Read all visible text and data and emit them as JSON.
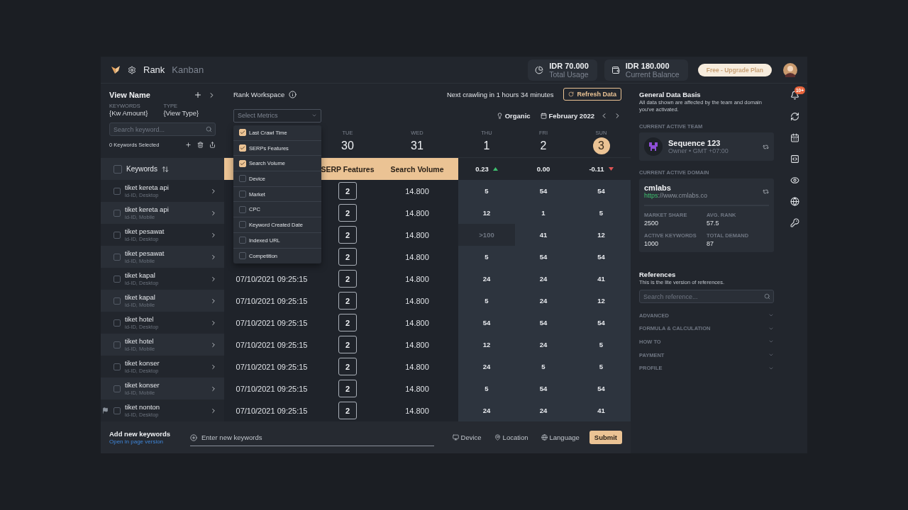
{
  "topbar": {
    "section": "Rank",
    "view": "Kanban",
    "usage": {
      "amount": "IDR 70.000",
      "label": "Total Usage"
    },
    "balance": {
      "amount": "IDR 180.000",
      "label": "Current Balance"
    },
    "plan_button": "Free - Upgrade Plan"
  },
  "view_panel": {
    "title": "View Name",
    "fields": [
      {
        "label": "KEYWORDS",
        "value": "{Kw Amount}"
      },
      {
        "label": "TYPE",
        "value": "{View Type}"
      }
    ],
    "search": {
      "placeholder": "Search keyword..."
    },
    "selected_count": "0 Keywords Selected",
    "column_header": "Keywords",
    "select_all_checked": false,
    "keywords": [
      {
        "name": "tiket kereta api",
        "meta": "id-ID, Desktop",
        "flagged": false,
        "checked": false
      },
      {
        "name": "tiket kereta api",
        "meta": "id-ID, Mobile",
        "flagged": false,
        "checked": false
      },
      {
        "name": "tiket pesawat",
        "meta": "id-ID, Desktop",
        "flagged": false,
        "checked": false
      },
      {
        "name": "tiket pesawat",
        "meta": "id-ID, Mobile",
        "flagged": false,
        "checked": false
      },
      {
        "name": "tiket kapal",
        "meta": "id-ID, Desktop",
        "flagged": false,
        "checked": false
      },
      {
        "name": "tiket kapal",
        "meta": "id-ID, Mobile",
        "flagged": false,
        "checked": false
      },
      {
        "name": "tiket hotel",
        "meta": "id-ID, Desktop",
        "flagged": false,
        "checked": false
      },
      {
        "name": "tiket hotel",
        "meta": "id-ID, Mobile",
        "flagged": false,
        "checked": false
      },
      {
        "name": "tiket konser",
        "meta": "id-ID, Desktop",
        "flagged": false,
        "checked": false
      },
      {
        "name": "tiket konser",
        "meta": "id-ID, Mobile",
        "flagged": false,
        "checked": false
      },
      {
        "name": "tiket nonton",
        "meta": "id-ID, Desktop",
        "flagged": true,
        "checked": false
      }
    ]
  },
  "workspace": {
    "title": "Rank Workspace",
    "next_crawl": "Next crawling in 1 hours 34 minutes",
    "refresh_button": "Refresh Data",
    "metrics_select": {
      "placeholder": "Select Metrics",
      "expanded": true,
      "options": [
        {
          "label": "Last Crawl Time",
          "checked": true
        },
        {
          "label": "SERPs Features",
          "checked": true
        },
        {
          "label": "Search Volume",
          "checked": true
        },
        {
          "label": "Device",
          "checked": false
        },
        {
          "label": "Market",
          "checked": false
        },
        {
          "label": "CPC",
          "checked": false
        },
        {
          "label": "Keyword Created Date",
          "checked": false
        },
        {
          "label": "Indexed URL",
          "checked": false
        },
        {
          "label": "Competition",
          "checked": false
        }
      ]
    },
    "filter": "Organic",
    "month": "February 2022",
    "days": [
      {
        "weekday": "TUE",
        "day": "30",
        "selected": false
      },
      {
        "weekday": "WED",
        "day": "31",
        "selected": false
      },
      {
        "weekday": "THU",
        "day": "1",
        "selected": false
      },
      {
        "weekday": "FRI",
        "day": "2",
        "selected": false
      },
      {
        "weekday": "SUN",
        "day": "3",
        "selected": true
      }
    ],
    "columns": [
      "SERP Features",
      "Search Volume"
    ],
    "deltas": [
      {
        "value": "0.23",
        "kind": "up"
      },
      {
        "value": "0.00",
        "kind": "flat"
      },
      {
        "value": "-0.11",
        "kind": "down"
      }
    ],
    "rows": [
      {
        "serp": "2",
        "volume": "14.800",
        "ranks": [
          {
            "value": "5",
            "muted": false
          },
          {
            "value": "54",
            "muted": false
          },
          {
            "value": "54",
            "muted": false
          }
        ]
      },
      {
        "serp": "2",
        "volume": "14.800",
        "ranks": [
          {
            "value": "12",
            "muted": false
          },
          {
            "value": "1",
            "muted": false
          },
          {
            "value": "5",
            "muted": false
          }
        ]
      },
      {
        "serp": "2",
        "volume": "14.800",
        "ranks": [
          {
            "value": ">100",
            "muted": true
          },
          {
            "value": "41",
            "muted": false
          },
          {
            "value": "12",
            "muted": false
          }
        ]
      },
      {
        "serp": "2",
        "volume": "14.800",
        "ranks": [
          {
            "value": "5",
            "muted": false
          },
          {
            "value": "54",
            "muted": false
          },
          {
            "value": "54",
            "muted": false
          }
        ]
      },
      {
        "last_crawl": "07/10/2021 09:25:15",
        "serp": "2",
        "volume": "14.800",
        "ranks": [
          {
            "value": "24",
            "muted": false
          },
          {
            "value": "24",
            "muted": false
          },
          {
            "value": "41",
            "muted": false
          }
        ]
      },
      {
        "last_crawl": "07/10/2021 09:25:15",
        "serp": "2",
        "volume": "14.800",
        "ranks": [
          {
            "value": "5",
            "muted": false
          },
          {
            "value": "24",
            "muted": false
          },
          {
            "value": "12",
            "muted": false
          }
        ]
      },
      {
        "last_crawl": "07/10/2021 09:25:15",
        "serp": "2",
        "volume": "14.800",
        "ranks": [
          {
            "value": "54",
            "muted": false
          },
          {
            "value": "54",
            "muted": false
          },
          {
            "value": "54",
            "muted": false
          }
        ]
      },
      {
        "last_crawl": "07/10/2021 09:25:15",
        "serp": "2",
        "volume": "14.800",
        "ranks": [
          {
            "value": "12",
            "muted": false
          },
          {
            "value": "24",
            "muted": false
          },
          {
            "value": "5",
            "muted": false
          }
        ]
      },
      {
        "last_crawl": "07/10/2021 09:25:15",
        "serp": "2",
        "volume": "14.800",
        "ranks": [
          {
            "value": "24",
            "muted": false
          },
          {
            "value": "5",
            "muted": false
          },
          {
            "value": "5",
            "muted": false
          }
        ]
      },
      {
        "last_crawl": "07/10/2021 09:25:15",
        "serp": "2",
        "volume": "14.800",
        "ranks": [
          {
            "value": "5",
            "muted": false
          },
          {
            "value": "54",
            "muted": false
          },
          {
            "value": "54",
            "muted": false
          }
        ]
      },
      {
        "last_crawl": "07/10/2021 09:25:15",
        "serp": "2",
        "volume": "14.800",
        "ranks": [
          {
            "value": "24",
            "muted": false
          },
          {
            "value": "24",
            "muted": false
          },
          {
            "value": "41",
            "muted": false
          }
        ]
      }
    ]
  },
  "bottom_bar": {
    "title": "Add new keywords",
    "link": "Open in page version",
    "input": {
      "placeholder": "Enter new keywords"
    },
    "options": [
      "Device",
      "Location",
      "Language"
    ],
    "submit": "Submit"
  },
  "data_basis": {
    "title": "General Data Basis",
    "description": "All data shown are affected by the team and domain you've activated.",
    "team_label": "CURRENT ACTIVE TEAM",
    "team": {
      "name": "Sequence 123",
      "meta": "Owner • GMT +07:00"
    },
    "domain_label": "CURRENT ACTIVE DOMAIN",
    "domain": {
      "name": "cmlabs",
      "url_scheme": "https",
      "url_rest": "://www.cmlabs.co",
      "stats": [
        {
          "label": "MARKET SHARE",
          "value": "2500"
        },
        {
          "label": "AVG. RANK",
          "value": "57.5"
        },
        {
          "label": "ACTIVE KEYWORDS",
          "value": "1000"
        },
        {
          "label": "TOTAL DEMAND",
          "value": "87"
        }
      ]
    }
  },
  "references": {
    "title": "References",
    "description": "This is the lite version of references.",
    "search": {
      "placeholder": "Search reference..."
    },
    "sections": [
      {
        "label": "ADVANCED",
        "expanded": false
      },
      {
        "label": "FORMULA & CALCULATION",
        "expanded": false
      },
      {
        "label": "HOW TO",
        "expanded": false
      },
      {
        "label": "PAYMENT",
        "expanded": false
      },
      {
        "label": "PROFILE",
        "expanded": false
      }
    ]
  },
  "rail": {
    "notification_badge": "10+"
  }
}
